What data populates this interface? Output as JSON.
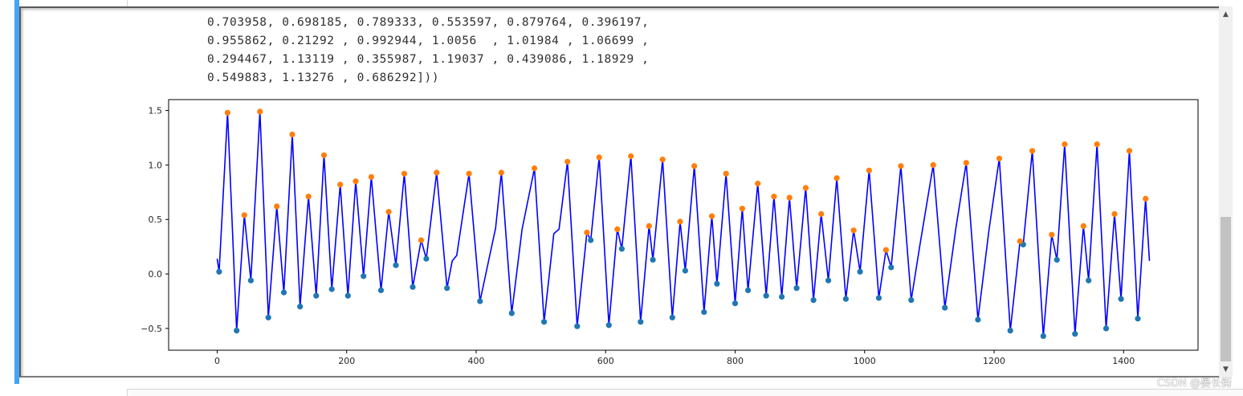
{
  "output_text": {
    "lines": [
      "0.703958, 0.698185, 0.789333, 0.553597, 0.879764, 0.396197,",
      "0.955862, 0.21292 , 0.992944, 1.0056  , 1.01984 , 1.06699 ,",
      "0.294467, 1.13119 , 0.355987, 1.19037 , 0.439086, 1.18929 ,",
      "0.549883, 1.13276 , 0.686292]))"
    ]
  },
  "watermark": "CSDN @晏长街",
  "colors": {
    "line": "#0000ff",
    "peak_marker": "#ff7f0e",
    "trough_marker": "#1f77b4",
    "accent": "#42a5f5"
  },
  "icons": {
    "scroll_up": "up-arrow-icon",
    "scroll_down": "down-arrow-icon"
  },
  "chart_data": {
    "type": "line",
    "xlim": [
      -75,
      1515
    ],
    "ylim": [
      -0.7,
      1.6
    ],
    "x_ticks": [
      0,
      200,
      400,
      600,
      800,
      1000,
      1200,
      1400
    ],
    "x_tick_labels": [
      "0",
      "200",
      "400",
      "600",
      "800",
      "1000",
      "1200",
      "1400"
    ],
    "y_ticks": [
      -0.5,
      0.0,
      0.5,
      1.0,
      1.5
    ],
    "y_tick_labels": [
      "−0.5",
      "0.0",
      "0.5",
      "1.0",
      "1.5"
    ],
    "grid": false,
    "x_range": [
      0,
      1440
    ],
    "series": [
      {
        "points": [
          [
            0,
            0.14
          ],
          [
            3,
            0.02
          ],
          [
            16,
            1.48
          ],
          [
            30,
            -0.52
          ],
          [
            42,
            0.54
          ],
          [
            52,
            -0.06
          ],
          [
            66,
            1.49
          ],
          [
            79,
            -0.4
          ],
          [
            92,
            0.62
          ],
          [
            103,
            -0.17
          ],
          [
            116,
            1.28
          ],
          [
            128,
            -0.3
          ],
          [
            141,
            0.71
          ],
          [
            153,
            -0.2
          ],
          [
            165,
            1.09
          ],
          [
            177,
            -0.14
          ],
          [
            190,
            0.82
          ],
          [
            202,
            -0.2
          ],
          [
            214,
            0.85
          ],
          [
            226,
            -0.02
          ],
          [
            238,
            0.89
          ],
          [
            253,
            -0.15
          ],
          [
            265,
            0.57
          ],
          [
            276,
            0.08
          ],
          [
            289,
            0.92
          ],
          [
            302,
            -0.12
          ],
          [
            315,
            0.31
          ],
          [
            323,
            0.14
          ],
          [
            339,
            0.93
          ],
          [
            355,
            -0.13
          ],
          [
            363,
            0.12
          ],
          [
            370,
            0.17
          ],
          [
            389,
            0.92
          ],
          [
            406,
            -0.25
          ],
          [
            421,
            0.17
          ],
          [
            430,
            0.42
          ],
          [
            439,
            0.93
          ],
          [
            455,
            -0.36
          ],
          [
            471,
            0.41
          ],
          [
            490,
            0.97
          ],
          [
            505,
            -0.44
          ],
          [
            520,
            0.37
          ],
          [
            528,
            0.41
          ],
          [
            541,
            1.03
          ],
          [
            556,
            -0.48
          ],
          [
            571,
            0.38
          ],
          [
            577,
            0.31
          ],
          [
            590,
            1.07
          ],
          [
            605,
            -0.47
          ],
          [
            618,
            0.41
          ],
          [
            625,
            0.23
          ],
          [
            639,
            1.08
          ],
          [
            654,
            -0.44
          ],
          [
            667,
            0.44
          ],
          [
            673,
            0.13
          ],
          [
            688,
            1.05
          ],
          [
            703,
            -0.4
          ],
          [
            715,
            0.48
          ],
          [
            723,
            0.03
          ],
          [
            737,
            0.99
          ],
          [
            752,
            -0.35
          ],
          [
            764,
            0.53
          ],
          [
            772,
            -0.09
          ],
          [
            786,
            0.92
          ],
          [
            800,
            -0.27
          ],
          [
            811,
            0.6
          ],
          [
            820,
            -0.15
          ],
          [
            835,
            0.83
          ],
          [
            848,
            -0.2
          ],
          [
            860,
            0.71
          ],
          [
            872,
            -0.21
          ],
          [
            884,
            0.7
          ],
          [
            895,
            -0.13
          ],
          [
            909,
            0.79
          ],
          [
            921,
            -0.24
          ],
          [
            933,
            0.55
          ],
          [
            944,
            -0.06
          ],
          [
            957,
            0.88
          ],
          [
            971,
            -0.23
          ],
          [
            983,
            0.4
          ],
          [
            993,
            0.02
          ],
          [
            1007,
            0.95
          ],
          [
            1022,
            -0.22
          ],
          [
            1033,
            0.22
          ],
          [
            1041,
            0.06
          ],
          [
            1056,
            0.99
          ],
          [
            1072,
            -0.24
          ],
          [
            1085,
            0.25
          ],
          [
            1106,
            1.0
          ],
          [
            1124,
            -0.31
          ],
          [
            1141,
            0.42
          ],
          [
            1157,
            1.02
          ],
          [
            1175,
            -0.42
          ],
          [
            1192,
            0.4
          ],
          [
            1208,
            1.06
          ],
          [
            1225,
            -0.52
          ],
          [
            1240,
            0.3
          ],
          [
            1245,
            0.27
          ],
          [
            1259,
            1.13
          ],
          [
            1276,
            -0.57
          ],
          [
            1289,
            0.36
          ],
          [
            1297,
            0.13
          ],
          [
            1309,
            1.19
          ],
          [
            1325,
            -0.55
          ],
          [
            1338,
            0.44
          ],
          [
            1346,
            -0.06
          ],
          [
            1359,
            1.19
          ],
          [
            1373,
            -0.5
          ],
          [
            1386,
            0.55
          ],
          [
            1396,
            -0.23
          ],
          [
            1409,
            1.13
          ],
          [
            1422,
            -0.41
          ],
          [
            1434,
            0.69
          ],
          [
            1440,
            0.12
          ]
        ]
      }
    ],
    "peaks": [
      [
        16,
        1.48
      ],
      [
        42,
        0.54
      ],
      [
        66,
        1.49
      ],
      [
        92,
        0.62
      ],
      [
        116,
        1.28
      ],
      [
        141,
        0.71
      ],
      [
        165,
        1.09
      ],
      [
        190,
        0.82
      ],
      [
        214,
        0.85
      ],
      [
        238,
        0.89
      ],
      [
        265,
        0.57
      ],
      [
        289,
        0.92
      ],
      [
        315,
        0.31
      ],
      [
        339,
        0.93
      ],
      [
        389,
        0.92
      ],
      [
        439,
        0.93
      ],
      [
        490,
        0.97
      ],
      [
        541,
        1.03
      ],
      [
        571,
        0.38
      ],
      [
        590,
        1.07
      ],
      [
        618,
        0.41
      ],
      [
        639,
        1.08
      ],
      [
        667,
        0.44
      ],
      [
        688,
        1.05
      ],
      [
        715,
        0.48
      ],
      [
        737,
        0.99
      ],
      [
        764,
        0.53
      ],
      [
        786,
        0.92
      ],
      [
        811,
        0.6
      ],
      [
        835,
        0.83
      ],
      [
        860,
        0.71
      ],
      [
        884,
        0.7
      ],
      [
        909,
        0.79
      ],
      [
        933,
        0.55
      ],
      [
        957,
        0.88
      ],
      [
        983,
        0.4
      ],
      [
        1007,
        0.95
      ],
      [
        1033,
        0.22
      ],
      [
        1056,
        0.99
      ],
      [
        1106,
        1.0
      ],
      [
        1157,
        1.02
      ],
      [
        1208,
        1.06
      ],
      [
        1240,
        0.3
      ],
      [
        1259,
        1.13
      ],
      [
        1289,
        0.36
      ],
      [
        1309,
        1.19
      ],
      [
        1338,
        0.44
      ],
      [
        1359,
        1.19
      ],
      [
        1386,
        0.55
      ],
      [
        1409,
        1.13
      ],
      [
        1434,
        0.69
      ]
    ],
    "troughs": [
      [
        3,
        0.02
      ],
      [
        30,
        -0.52
      ],
      [
        52,
        -0.06
      ],
      [
        79,
        -0.4
      ],
      [
        103,
        -0.17
      ],
      [
        128,
        -0.3
      ],
      [
        153,
        -0.2
      ],
      [
        177,
        -0.14
      ],
      [
        202,
        -0.2
      ],
      [
        226,
        -0.02
      ],
      [
        253,
        -0.15
      ],
      [
        276,
        0.08
      ],
      [
        302,
        -0.12
      ],
      [
        323,
        0.14
      ],
      [
        355,
        -0.13
      ],
      [
        406,
        -0.25
      ],
      [
        455,
        -0.36
      ],
      [
        505,
        -0.44
      ],
      [
        556,
        -0.48
      ],
      [
        577,
        0.31
      ],
      [
        605,
        -0.47
      ],
      [
        625,
        0.23
      ],
      [
        654,
        -0.44
      ],
      [
        673,
        0.13
      ],
      [
        703,
        -0.4
      ],
      [
        723,
        0.03
      ],
      [
        752,
        -0.35
      ],
      [
        772,
        -0.09
      ],
      [
        800,
        -0.27
      ],
      [
        820,
        -0.15
      ],
      [
        848,
        -0.2
      ],
      [
        872,
        -0.21
      ],
      [
        895,
        -0.13
      ],
      [
        921,
        -0.24
      ],
      [
        944,
        -0.06
      ],
      [
        971,
        -0.23
      ],
      [
        993,
        0.02
      ],
      [
        1022,
        -0.22
      ],
      [
        1041,
        0.06
      ],
      [
        1072,
        -0.24
      ],
      [
        1124,
        -0.31
      ],
      [
        1175,
        -0.42
      ],
      [
        1225,
        -0.52
      ],
      [
        1245,
        0.27
      ],
      [
        1276,
        -0.57
      ],
      [
        1297,
        0.13
      ],
      [
        1325,
        -0.55
      ],
      [
        1346,
        -0.06
      ],
      [
        1373,
        -0.5
      ],
      [
        1396,
        -0.23
      ],
      [
        1422,
        -0.41
      ]
    ]
  }
}
